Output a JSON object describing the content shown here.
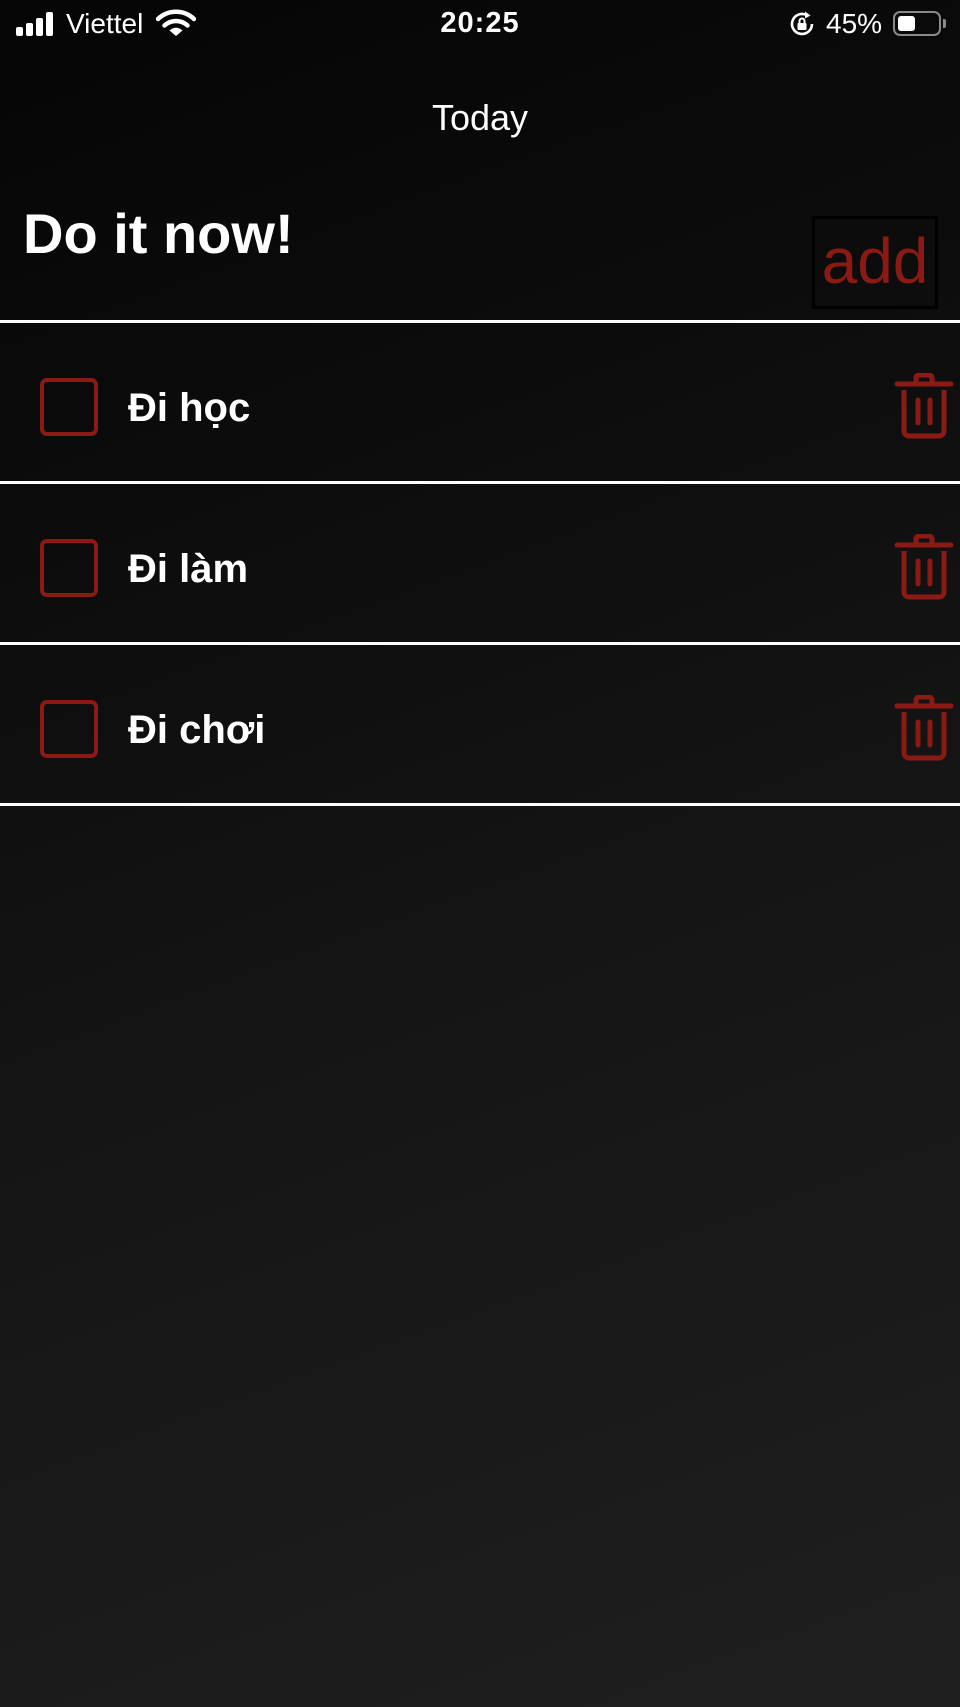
{
  "status_bar": {
    "carrier": "Viettel",
    "time": "20:25",
    "battery_percent": "45%",
    "battery_level": 0.45,
    "icons": [
      "cellular-signal-icon",
      "wifi-icon",
      "rotation-lock-icon",
      "battery-icon"
    ]
  },
  "nav": {
    "title": "Today"
  },
  "header": {
    "title": "Do it now!",
    "add_label": "add"
  },
  "tasks": [
    {
      "label": "Đi học",
      "checked": false
    },
    {
      "label": "Đi làm",
      "checked": false
    },
    {
      "label": "Đi chơi",
      "checked": false
    }
  ],
  "colors": {
    "accent": "#8b1a14",
    "text": "#ffffff",
    "divider": "#ffffff",
    "background": "#0d0d0d"
  }
}
